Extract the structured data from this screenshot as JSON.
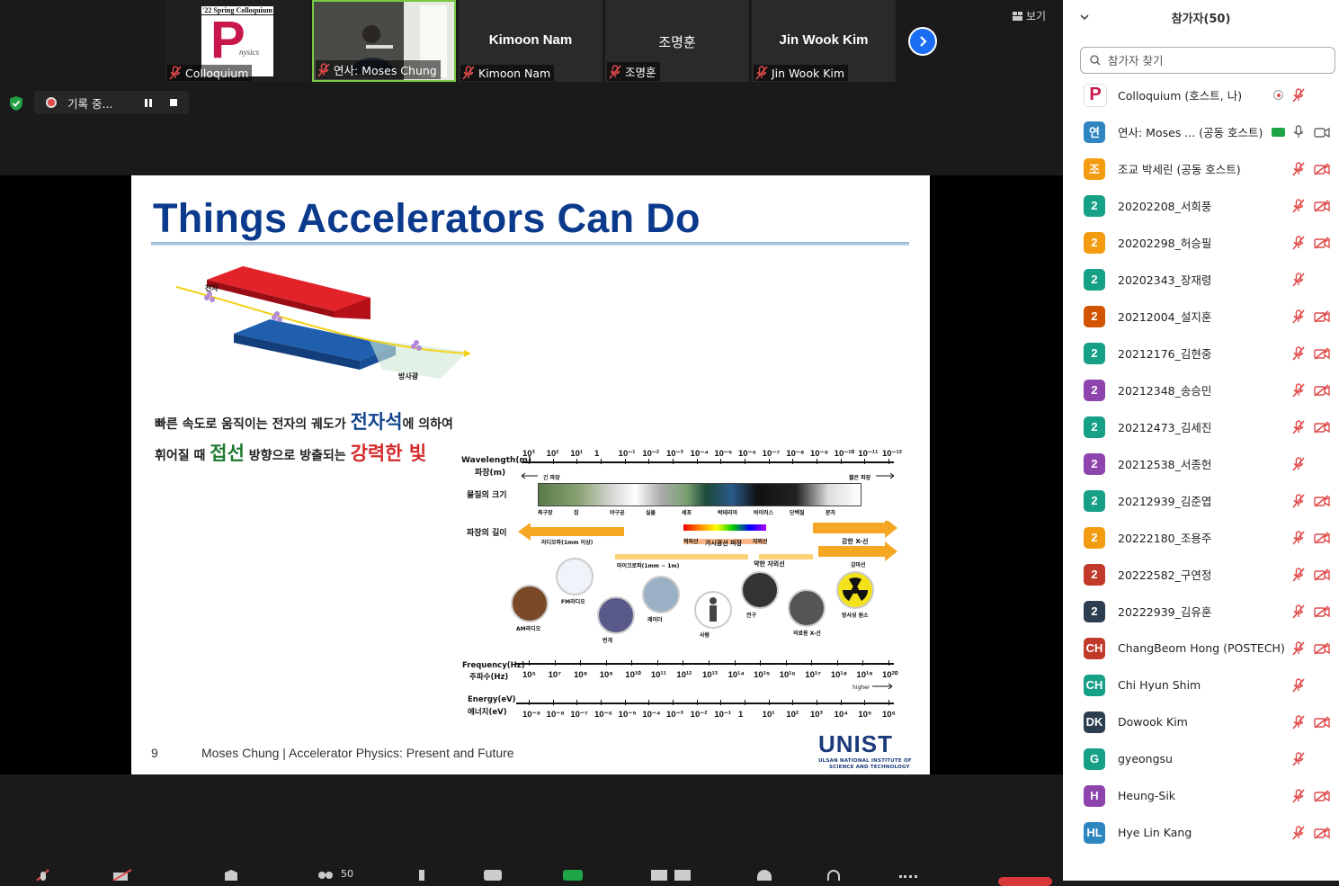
{
  "tiles": [
    {
      "name": "Colloquium",
      "center": "",
      "has_logo": true,
      "logo_banner": "'22 Spring Colloquium",
      "logo_letter": "P",
      "logo_text": "nysics"
    },
    {
      "name": "연사: Moses Chung",
      "center": "",
      "has_video": true
    },
    {
      "name": "Kimoon Nam",
      "center": "Kimoon Nam"
    },
    {
      "name": "조명훈",
      "center": "조명훈"
    },
    {
      "name": "Jin Wook Kim",
      "center": "Jin Wook Kim"
    }
  ],
  "view_label": "보기",
  "recording": {
    "label": "기록 중..."
  },
  "slide": {
    "title": "Things Accelerators Can Do",
    "line1_a": "빠른 속도로 움직이는 전자의 궤도가 ",
    "line1_b": "전자석",
    "line1_c": "에 의하여",
    "line2_a": "휘어질 때 ",
    "line2_b": "접선",
    "line2_c": " 방향으로 방출되는 ",
    "line2_d": "강력한 빛",
    "diagram_electron": "전자",
    "diagram_light": "방사광",
    "page_number": "9",
    "footer": "Moses Chung | Accelerator Physics: Present and Future",
    "unist_logo": "UNIST",
    "unist_sub1": "ULSAN NATIONAL INSTITUTE OF",
    "unist_sub2": "SCIENCE AND TECHNOLOGY",
    "spectrum": {
      "wavelength_label": "Wavelength(m)",
      "wavelength_label_ko": "파장(m)",
      "wavelength_ticks": [
        "10³",
        "10²",
        "10¹",
        "1",
        "10⁻¹",
        "10⁻²",
        "10⁻³",
        "10⁻⁴",
        "10⁻⁵",
        "10⁻⁶",
        "10⁻⁷",
        "10⁻⁸",
        "10⁻⁹",
        "10⁻¹⁰",
        "10⁻¹¹",
        "10⁻¹²"
      ],
      "long_wave": "긴 파장",
      "short_wave": "짧은 파장",
      "size_label": "물질의 크기",
      "size_items": [
        "축구장",
        "집",
        "야구공",
        "실몰",
        "세포",
        "박테리아",
        "바이러스",
        "단백질",
        "분자"
      ],
      "wave_length_label": "파장의 길이",
      "radio": "라디오파(1mm 이상)",
      "microwave": "마이크로파(1mm ~ 1m)",
      "infrared": "적외선",
      "visible": "가시광선 파장",
      "ultraviolet": "자외선",
      "weak_uv": "약한 자외선",
      "strong_xray": "강한 X-선",
      "gamma": "감마선",
      "sources": [
        "AM라디오",
        "FM라디오",
        "번개",
        "레이더",
        "사람",
        "전구",
        "의료용 X-선",
        "방사성 원소"
      ],
      "frequency_label": "Frequency(Hz)",
      "frequency_label_ko": "주파수(Hz)",
      "frequency_ticks": [
        "10⁶",
        "10⁷",
        "10⁸",
        "10⁹",
        "10¹⁰",
        "10¹¹",
        "10¹²",
        "10¹³",
        "10¹⁴",
        "10¹⁵",
        "10¹⁶",
        "10¹⁷",
        "10¹⁸",
        "10¹⁹",
        "10²⁰"
      ],
      "higher": "higher",
      "energy_label": "Energy(eV)",
      "energy_label_ko": "에너지(eV)",
      "energy_ticks": [
        "10⁻⁹",
        "10⁻⁸",
        "10⁻⁷",
        "10⁻⁶",
        "10⁻⁵",
        "10⁻⁴",
        "10⁻³",
        "10⁻²",
        "10⁻¹",
        "1",
        "10¹",
        "10²",
        "10³",
        "10⁴",
        "10⁵",
        "10⁶"
      ]
    }
  },
  "panel": {
    "title": "참가자(50)",
    "search_placeholder": "참가자 찾기",
    "participants": [
      {
        "initial": "P",
        "name": "Colloquium (호스트, 나)",
        "color": "#ffffff",
        "logo": true,
        "mic": "off",
        "cam": "none",
        "extra": "record"
      },
      {
        "initial": "연",
        "name": "연사: Moses ... (공동 호스트)",
        "color": "#2e86c1",
        "mic": "on",
        "cam": "on",
        "extra": "share"
      },
      {
        "initial": "조",
        "name": "조교 박세린 (공동 호스트)",
        "color": "#f39c12",
        "mic": "off",
        "cam": "off"
      },
      {
        "initial": "2",
        "name": "20202208_서희풍",
        "color": "#16a085",
        "mic": "off",
        "cam": "off"
      },
      {
        "initial": "2",
        "name": "20202298_허승필",
        "color": "#f39c12",
        "mic": "off",
        "cam": "off"
      },
      {
        "initial": "2",
        "name": "20202343_장재령",
        "color": "#16a085",
        "mic": "off",
        "cam": "none"
      },
      {
        "initial": "2",
        "name": "20212004_설지훈",
        "color": "#d35400",
        "mic": "off",
        "cam": "off"
      },
      {
        "initial": "2",
        "name": "20212176_김현중",
        "color": "#16a085",
        "mic": "off",
        "cam": "off"
      },
      {
        "initial": "2",
        "name": "20212348_송승민",
        "color": "#8e44ad",
        "mic": "off",
        "cam": "off"
      },
      {
        "initial": "2",
        "name": "20212473_김세진",
        "color": "#16a085",
        "mic": "off",
        "cam": "off"
      },
      {
        "initial": "2",
        "name": "20212538_서종헌",
        "color": "#8e44ad",
        "mic": "off",
        "cam": "none"
      },
      {
        "initial": "2",
        "name": "20212939_김준엽",
        "color": "#16a085",
        "mic": "off",
        "cam": "off"
      },
      {
        "initial": "2",
        "name": "20222180_조용주",
        "color": "#f39c12",
        "mic": "off",
        "cam": "off"
      },
      {
        "initial": "2",
        "name": "20222582_구연정",
        "color": "#c0392b",
        "mic": "off",
        "cam": "off"
      },
      {
        "initial": "2",
        "name": "20222939_김유훈",
        "color": "#2c3e50",
        "mic": "off",
        "cam": "off"
      },
      {
        "initial": "CH",
        "name": "ChangBeom Hong (POSTECH)",
        "color": "#c0392b",
        "mic": "off",
        "cam": "off"
      },
      {
        "initial": "CH",
        "name": "Chi Hyun Shim",
        "color": "#16a085",
        "mic": "off",
        "cam": "none"
      },
      {
        "initial": "DK",
        "name": "Dowook Kim",
        "color": "#2c3e50",
        "mic": "off",
        "cam": "off"
      },
      {
        "initial": "G",
        "name": "gyeongsu",
        "color": "#16a085",
        "mic": "off",
        "cam": "none"
      },
      {
        "initial": "H",
        "name": "Heung-Sik",
        "color": "#8e44ad",
        "mic": "off",
        "cam": "off"
      },
      {
        "initial": "HL",
        "name": "Hye Lin Kang",
        "color": "#2e86c1",
        "mic": "off",
        "cam": "off"
      }
    ]
  },
  "toolbar": {
    "participants_count": "50"
  }
}
